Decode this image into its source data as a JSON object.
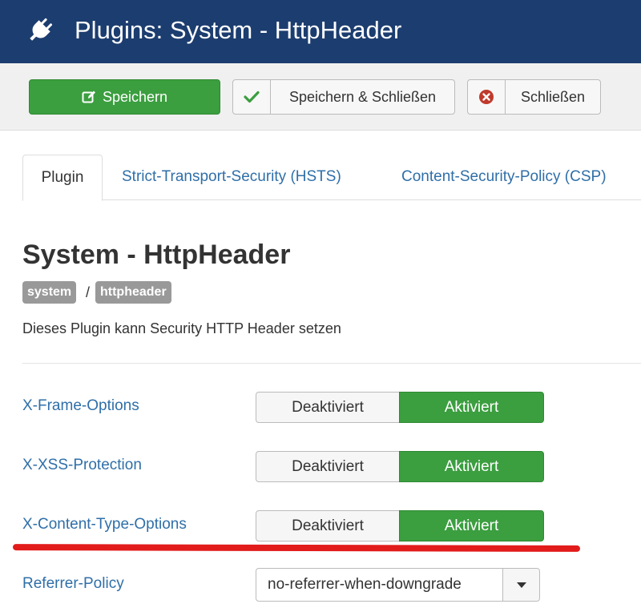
{
  "header": {
    "title": "Plugins: System - HttpHeader",
    "icon": "plug-icon",
    "bg_color": "#1c3d6f"
  },
  "toolbar": {
    "save_label": "Speichern",
    "save_close_label": "Speichern & Schließen",
    "close_label": "Schließen",
    "save_color": "#3b9e3f"
  },
  "tabs": [
    {
      "label": "Plugin",
      "active": true
    },
    {
      "label": "Strict-Transport-Security (HSTS)",
      "active": false
    },
    {
      "label": "Content-Security-Policy (CSP)",
      "active": false
    }
  ],
  "plugin": {
    "title": "System - HttpHeader",
    "badge_group": "system",
    "separator": "/",
    "badge_element": "httpheader",
    "description": "Dieses Plugin kann Security HTTP Header setzen"
  },
  "fields": [
    {
      "label": "X-Frame-Options",
      "off_label": "Deaktiviert",
      "on_label": "Aktiviert",
      "value": "Aktiviert"
    },
    {
      "label": "X-XSS-Protection",
      "off_label": "Deaktiviert",
      "on_label": "Aktiviert",
      "value": "Aktiviert"
    },
    {
      "label": "X-Content-Type-Options",
      "off_label": "Deaktiviert",
      "on_label": "Aktiviert",
      "value": "Aktiviert"
    }
  ],
  "referrer_policy": {
    "label": "Referrer-Policy",
    "selected": "no-referrer-when-downgrade"
  },
  "annotation": {
    "highlight_color": "#e21b1b"
  }
}
